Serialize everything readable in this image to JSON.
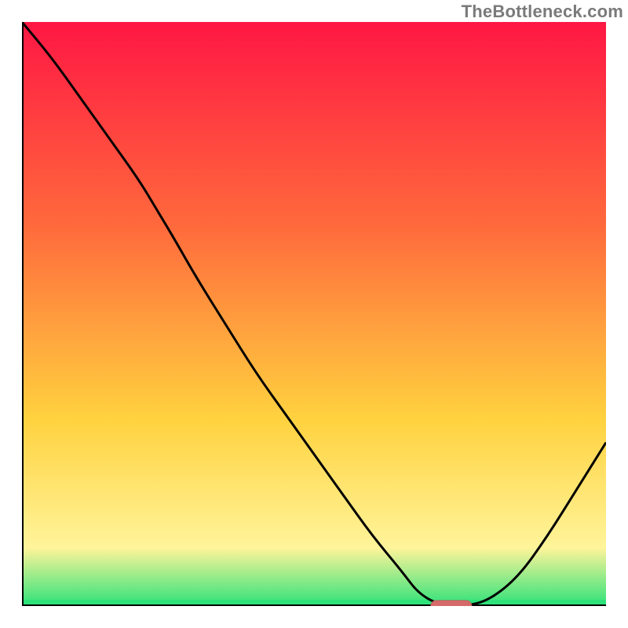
{
  "watermark": "TheBottleneck.com",
  "colors": {
    "curve": "#000000",
    "axis": "#000000",
    "marker_fill": "#d46a6a",
    "marker_stroke": "#c65b5b",
    "grad_top": "#ff1744",
    "grad_mid1": "#ff6a3c",
    "grad_mid2": "#ffd23f",
    "grad_low": "#fff49a",
    "grad_bottom": "#2ee27a"
  },
  "chart_data": {
    "type": "line",
    "title": "",
    "xlabel": "",
    "ylabel": "",
    "xlim": [
      0,
      100
    ],
    "ylim": [
      0,
      100
    ],
    "x": [
      0,
      5,
      10,
      15,
      20,
      23,
      26,
      30,
      35,
      40,
      45,
      50,
      55,
      60,
      65,
      68,
      72,
      76,
      80,
      85,
      90,
      95,
      100
    ],
    "y": [
      100,
      94,
      87,
      80,
      73,
      68,
      63,
      56,
      48,
      40,
      33,
      26,
      19,
      12,
      6,
      2,
      0,
      0,
      1,
      5,
      12,
      20,
      28
    ],
    "marker": {
      "x_start": 70,
      "x_end": 77,
      "y": 0
    },
    "background": "rainbow-heat-gradient",
    "annotations": [
      "TheBottleneck.com"
    ]
  }
}
